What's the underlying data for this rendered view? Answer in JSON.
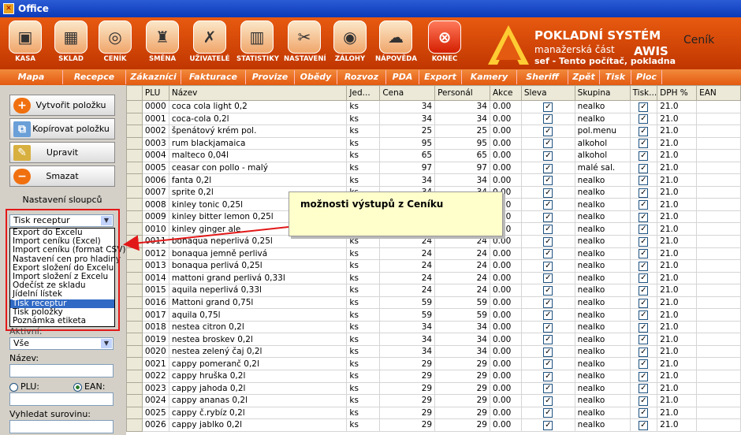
{
  "window": {
    "title": "Office"
  },
  "toolbar": {
    "buttons": [
      {
        "label": "KASA",
        "icon": "cash-register-icon"
      },
      {
        "label": "SKLAD",
        "icon": "boxes-icon"
      },
      {
        "label": "CENÍK",
        "icon": "coins-icon"
      },
      {
        "label": "SMĚNA",
        "icon": "waiter-icon"
      },
      {
        "label": "UŽIVATELÉ",
        "icon": "users-icon"
      },
      {
        "label": "STATISTIKY",
        "icon": "chart-icon"
      },
      {
        "label": "NASTAVENÍ",
        "icon": "tools-icon"
      },
      {
        "label": "ZÁLOHY",
        "icon": "disc-icon"
      },
      {
        "label": "NÁPOVĚDA",
        "icon": "help-icon"
      },
      {
        "label": "KONEC",
        "icon": "exit-icon"
      }
    ],
    "brand_title": "POKLADNÍ SYSTÉM",
    "brand_sub": "manažerská část",
    "brand_awis": "AWIS",
    "brand_sef": "sef  -  Tento počítač, pokladna",
    "brand_section": "Ceník"
  },
  "menu": [
    "Mapa podniku",
    "Recepce",
    "Zákazníci",
    "Fakturace",
    "Provize",
    "Obědy",
    "Rozvoz",
    "PDA",
    "Export",
    "Kamery",
    "Sheriff",
    "Zpět",
    "Tisk",
    "Ploc"
  ],
  "left": {
    "create": "Vytvořit položku",
    "copy": "Kopírovat položku",
    "edit": "Upravit",
    "delete": "Smazat",
    "columns": "Nastavení sloupců",
    "output_select": "Tisk receptur",
    "dropdown_options": [
      "Export do Excelu",
      "Import ceníku (Excel)",
      "Import ceníku (format CSV)",
      "Nastavení cen pro hladiny",
      "Export složení do Excelu",
      "Import složení z Excelu",
      "Odečíst ze skladu",
      "Jídelní lístek",
      "Tisk receptur",
      "Tisk položky",
      "Poznámka etiketa"
    ],
    "selected_option": "Tisk receptur",
    "aktivni_label": "Aktivní:",
    "aktivni_value": "Vše",
    "nazev_label": "Název:",
    "plu_label": "PLU:",
    "ean_label": "EAN:",
    "search_label": "Vyhledat surovinu:"
  },
  "callout": "možnosti výstupů z Ceníku",
  "grid": {
    "columns": [
      "PLU",
      "Název",
      "Jed...",
      "Cena",
      "Personál",
      "Akce",
      "Sleva",
      "Skupina",
      "Tisk...",
      "DPH %",
      "EAN"
    ],
    "rows": [
      [
        "0000",
        "coca cola light 0,2",
        "ks",
        "34",
        "34",
        "0.00",
        "nealko",
        "21.0"
      ],
      [
        "0001",
        "coca-cola 0,2l",
        "ks",
        "34",
        "34",
        "0.00",
        "nealko",
        "21.0"
      ],
      [
        "0002",
        "špenátový krém pol.",
        "ks",
        "25",
        "25",
        "0.00",
        "pol.menu",
        "21.0"
      ],
      [
        "0003",
        "rum blackjamaica",
        "ks",
        "95",
        "95",
        "0.00",
        "alkohol",
        "21.0"
      ],
      [
        "0004",
        "malteco 0,04l",
        "ks",
        "65",
        "65",
        "0.00",
        "alkohol",
        "21.0"
      ],
      [
        "0005",
        "ceasar con pollo - malý",
        "ks",
        "97",
        "97",
        "0.00",
        "malé sal.",
        "21.0"
      ],
      [
        "0006",
        "fanta 0,2l",
        "ks",
        "34",
        "34",
        "0.00",
        "nealko",
        "21.0"
      ],
      [
        "0007",
        "sprite 0,2l",
        "ks",
        "34",
        "34",
        "0.00",
        "nealko",
        "21.0"
      ],
      [
        "0008",
        "kinley tonic 0,25l",
        "ks",
        "34",
        "34",
        "0.00",
        "nealko",
        "21.0"
      ],
      [
        "0009",
        "kinley bitter lemon 0,25l",
        "ks",
        "34",
        "34",
        "0.00",
        "nealko",
        "21.0"
      ],
      [
        "0010",
        "kinley ginger ale",
        "ks",
        "34",
        "34",
        "0.00",
        "nealko",
        "21.0"
      ],
      [
        "0011",
        "bonaqua neperlivá 0,25l",
        "ks",
        "24",
        "24",
        "0.00",
        "nealko",
        "21.0"
      ],
      [
        "0012",
        "bonaqua jemně perlivá",
        "ks",
        "24",
        "24",
        "0.00",
        "nealko",
        "21.0"
      ],
      [
        "0013",
        "bonaqua perlivá 0,25l",
        "ks",
        "24",
        "24",
        "0.00",
        "nealko",
        "21.0"
      ],
      [
        "0014",
        "mattoni grand perlivá 0,33l",
        "ks",
        "24",
        "24",
        "0.00",
        "nealko",
        "21.0"
      ],
      [
        "0015",
        "aquila neperlivá 0,33l",
        "ks",
        "24",
        "24",
        "0.00",
        "nealko",
        "21.0"
      ],
      [
        "0016",
        "Mattoni grand 0,75l",
        "ks",
        "59",
        "59",
        "0.00",
        "nealko",
        "21.0"
      ],
      [
        "0017",
        "aquila 0,75l",
        "ks",
        "59",
        "59",
        "0.00",
        "nealko",
        "21.0"
      ],
      [
        "0018",
        "nestea citron 0,2l",
        "ks",
        "34",
        "34",
        "0.00",
        "nealko",
        "21.0"
      ],
      [
        "0019",
        "nestea broskev 0,2l",
        "ks",
        "34",
        "34",
        "0.00",
        "nealko",
        "21.0"
      ],
      [
        "0020",
        "nestea zelený čaj 0,2l",
        "ks",
        "34",
        "34",
        "0.00",
        "nealko",
        "21.0"
      ],
      [
        "0021",
        "cappy pomeranč 0,2l",
        "ks",
        "29",
        "29",
        "0.00",
        "nealko",
        "21.0"
      ],
      [
        "0022",
        "cappy hruška 0,2l",
        "ks",
        "29",
        "29",
        "0.00",
        "nealko",
        "21.0"
      ],
      [
        "0023",
        "cappy jahoda 0,2l",
        "ks",
        "29",
        "29",
        "0.00",
        "nealko",
        "21.0"
      ],
      [
        "0024",
        "cappy ananas 0,2l",
        "ks",
        "29",
        "29",
        "0.00",
        "nealko",
        "21.0"
      ],
      [
        "0025",
        "cappy č.rybíz 0,2l",
        "ks",
        "29",
        "29",
        "0.00",
        "nealko",
        "21.0"
      ],
      [
        "0026",
        "cappy jablko 0,2l",
        "ks",
        "29",
        "29",
        "0.00",
        "nealko",
        "21.0"
      ]
    ]
  }
}
